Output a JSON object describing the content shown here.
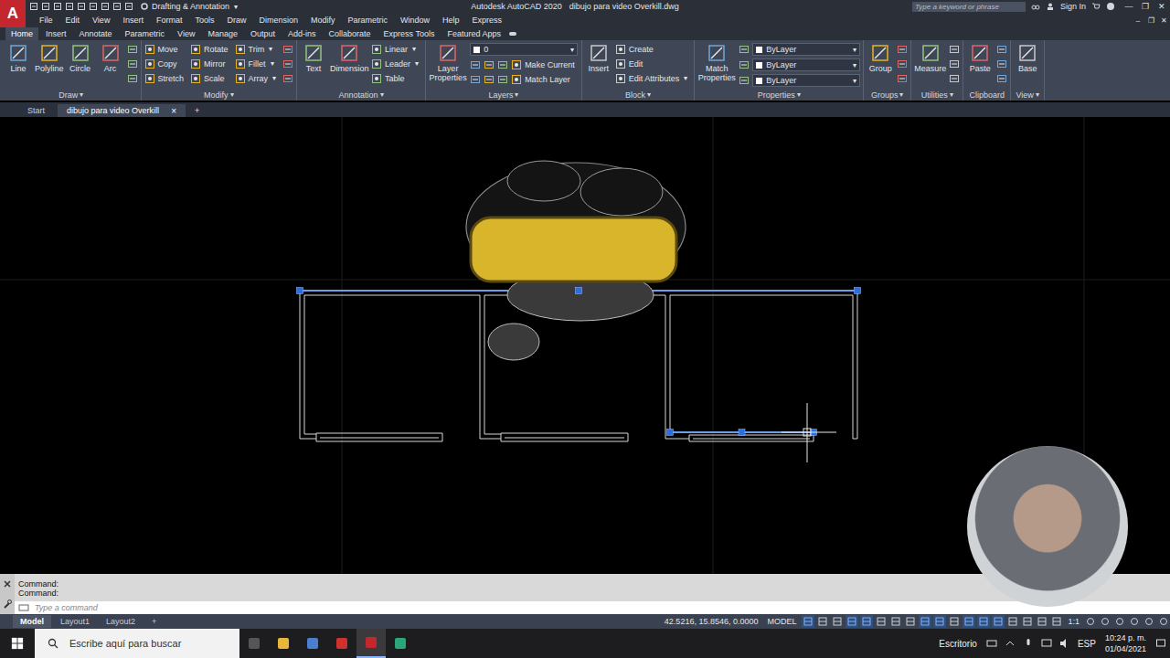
{
  "app": {
    "logo": "A",
    "workspace": "Drafting & Annotation",
    "workspace_arrow": "▾",
    "product": "Autodesk AutoCAD 2020",
    "document": "dibujo para video Overkill.dwg",
    "search_placeholder": "Type a keyword or phrase",
    "sign_in": "Sign In",
    "window_controls": [
      "—",
      "❐",
      "✕"
    ],
    "doc_controls": [
      "–",
      "❐",
      "✕"
    ]
  },
  "menu": [
    "File",
    "Edit",
    "View",
    "Insert",
    "Format",
    "Tools",
    "Draw",
    "Dimension",
    "Modify",
    "Parametric",
    "Window",
    "Help",
    "Express"
  ],
  "ribbon": {
    "tabs": [
      {
        "label": "Home",
        "selected": true
      },
      {
        "label": "Insert",
        "selected": false
      },
      {
        "label": "Annotate",
        "selected": false
      },
      {
        "label": "Parametric",
        "selected": false
      },
      {
        "label": "View",
        "selected": false
      },
      {
        "label": "Manage",
        "selected": false
      },
      {
        "label": "Output",
        "selected": false
      },
      {
        "label": "Add-ins",
        "selected": false
      },
      {
        "label": "Collaborate",
        "selected": false
      },
      {
        "label": "Express Tools",
        "selected": false
      },
      {
        "label": "Featured Apps",
        "selected": false
      }
    ],
    "groups": [
      {
        "title": "Draw",
        "arrow": "▾",
        "large": [
          {
            "label": "Line"
          },
          {
            "label": "Polyline"
          },
          {
            "label": "Circle"
          },
          {
            "label": "Arc"
          }
        ],
        "columns": [
          [
            [
              {
                "kind": "icon"
              }
            ],
            [
              {
                "kind": "icon"
              }
            ],
            [
              {
                "kind": "icon"
              }
            ]
          ]
        ]
      },
      {
        "title": "Modify",
        "arrow": "▾",
        "large": [],
        "columns": [
          [
            [
              {
                "kind": "button",
                "label": "Move"
              }
            ],
            [
              {
                "kind": "button",
                "label": "Copy"
              }
            ],
            [
              {
                "kind": "button",
                "label": "Stretch"
              }
            ]
          ],
          [
            [
              {
                "kind": "button",
                "label": "Rotate"
              }
            ],
            [
              {
                "kind": "button",
                "label": "Mirror"
              }
            ],
            [
              {
                "kind": "button",
                "label": "Scale"
              }
            ]
          ],
          [
            [
              {
                "kind": "button",
                "label": "Trim",
                "arrow": "▾"
              }
            ],
            [
              {
                "kind": "button",
                "label": "Fillet",
                "arrow": "▾"
              }
            ],
            [
              {
                "kind": "button",
                "label": "Array",
                "arrow": "▾"
              }
            ]
          ],
          [
            [
              {
                "kind": "icon"
              }
            ],
            [
              {
                "kind": "icon"
              }
            ],
            [
              {
                "kind": "icon"
              }
            ]
          ]
        ]
      },
      {
        "title": "Annotation",
        "arrow": "▾",
        "large": [
          {
            "label": "Text"
          },
          {
            "label": "Dimension"
          }
        ],
        "columns": [
          [
            [
              {
                "kind": "button",
                "label": "Linear",
                "arrow": "▾"
              }
            ],
            [
              {
                "kind": "button",
                "label": "Leader",
                "arrow": "▾"
              }
            ],
            [
              {
                "kind": "button",
                "label": "Table"
              }
            ]
          ]
        ]
      },
      {
        "title": "Layers",
        "arrow": "▾",
        "large": [
          {
            "label": "Layer Properties"
          }
        ],
        "columns": [
          [
            [
              {
                "kind": "dropdown",
                "label": "0",
                "arrow": "▾"
              }
            ],
            [
              {
                "kind": "icon"
              },
              {
                "kind": "icon"
              },
              {
                "kind": "icon"
              },
              {
                "kind": "button",
                "label": "Make Current"
              }
            ],
            [
              {
                "kind": "icon"
              },
              {
                "kind": "icon"
              },
              {
                "kind": "icon"
              },
              {
                "kind": "button",
                "label": "Match Layer"
              }
            ]
          ]
        ]
      },
      {
        "title": "Block",
        "arrow": "▾",
        "large": [
          {
            "label": "Insert"
          }
        ],
        "columns": [
          [
            [
              {
                "kind": "button",
                "label": "Create"
              }
            ],
            [
              {
                "kind": "button",
                "label": "Edit"
              }
            ],
            [
              {
                "kind": "button",
                "label": "Edit Attributes",
                "arrow": "▾"
              }
            ]
          ]
        ]
      },
      {
        "title": "Properties",
        "arrow": "▾",
        "large": [
          {
            "label": "Match Properties"
          }
        ],
        "columns": [
          [
            [
              {
                "kind": "icon"
              },
              {
                "kind": "dropdown",
                "label": "ByLayer",
                "arrow": "▾"
              }
            ],
            [
              {
                "kind": "icon"
              },
              {
                "kind": "dropdown",
                "label": "ByLayer",
                "arrow": "▾"
              }
            ],
            [
              {
                "kind": "icon"
              },
              {
                "kind": "dropdown",
                "label": "ByLayer",
                "arrow": "▾"
              }
            ]
          ]
        ]
      },
      {
        "title": "Groups",
        "arrow": "▾",
        "large": [
          {
            "label": "Group"
          }
        ],
        "columns": [
          [
            [
              {
                "kind": "icon"
              }
            ],
            [
              {
                "kind": "icon"
              }
            ],
            [
              {
                "kind": "icon"
              }
            ]
          ]
        ]
      },
      {
        "title": "Utilities",
        "arrow": "▾",
        "large": [
          {
            "label": "Measure"
          }
        ],
        "columns": [
          [
            [
              {
                "kind": "icon"
              }
            ],
            [
              {
                "kind": "icon"
              }
            ],
            [
              {
                "kind": "icon"
              }
            ]
          ]
        ]
      },
      {
        "title": "Clipboard",
        "arrow": "",
        "large": [
          {
            "label": "Paste"
          }
        ],
        "columns": [
          [
            [
              {
                "kind": "icon"
              }
            ],
            [
              {
                "kind": "icon"
              }
            ],
            [
              {
                "kind": "icon"
              }
            ]
          ]
        ]
      },
      {
        "title": "View",
        "arrow": "▾",
        "large": [
          {
            "label": "Base"
          }
        ],
        "columns": []
      }
    ]
  },
  "file_tabs": [
    {
      "label": "Start",
      "selected": false
    },
    {
      "label": "dibujo para video Overkill",
      "selected": true,
      "close": "×"
    }
  ],
  "new_tab": "+",
  "drawing": {
    "entities": [
      {
        "selected": true
      },
      {
        "selected": false
      },
      {
        "selected": false
      },
      {
        "selected": false
      },
      {
        "selected": false
      },
      {
        "selected": false
      },
      {
        "selected": false
      },
      {
        "selected": false
      },
      {
        "selected": false
      },
      {
        "selected": false
      },
      {
        "selected": false
      },
      {
        "selected": false
      },
      {
        "selected": false
      },
      {
        "selected": false
      },
      {
        "selected": false
      },
      {
        "selected": false
      },
      {
        "selected": false
      },
      {
        "selected": true
      }
    ]
  },
  "command": {
    "history": [
      "Command:",
      "Command:"
    ],
    "placeholder": "Type a command"
  },
  "status": {
    "layouts": [
      {
        "label": "Model",
        "selected": true
      },
      {
        "label": "Layout1",
        "selected": false
      },
      {
        "label": "Layout2",
        "selected": false
      }
    ],
    "add": "+",
    "coordinates": "42.5216, 15.8546, 0.0000",
    "space": "MODEL",
    "scale": "1:1",
    "toggles": [
      {
        "on": true
      },
      {
        "on": false
      },
      {
        "on": false
      },
      {
        "on": true
      },
      {
        "on": true
      },
      {
        "on": false
      },
      {
        "on": false
      },
      {
        "on": false
      },
      {
        "on": true
      },
      {
        "on": true
      },
      {
        "on": false
      },
      {
        "on": true
      },
      {
        "on": true
      },
      {
        "on": true
      },
      {
        "on": false
      },
      {
        "on": false
      },
      {
        "on": false
      },
      {
        "on": false
      },
      {
        "on": false
      },
      {
        "on": false
      },
      {
        "on": false
      },
      {
        "on": false
      },
      {
        "on": false
      },
      {
        "on": false
      }
    ]
  },
  "taskbar": {
    "search_placeholder": "Escribe aquí para buscar",
    "apps": [
      {
        "active": false
      },
      {
        "active": false
      },
      {
        "active": false
      },
      {
        "active": false
      },
      {
        "active": true
      },
      {
        "active": false
      }
    ],
    "desktop": "Escritorio",
    "language": "ESP",
    "time": "10:24 p. m.",
    "date": "01/04/2021"
  }
}
